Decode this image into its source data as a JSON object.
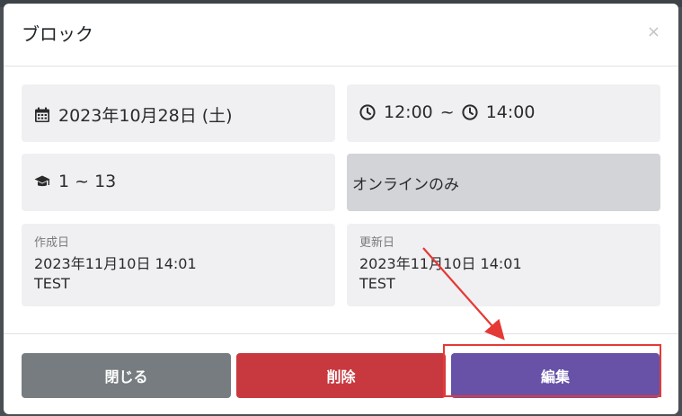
{
  "modal": {
    "title": "ブロック",
    "close_label": "×"
  },
  "date_card": {
    "icon": "calendar-icon",
    "text": "2023年10月28日 (土)"
  },
  "time_card": {
    "icon": "clock-icon",
    "start": "12:00",
    "separator": "~",
    "end": "14:00"
  },
  "seat_card": {
    "icon": "graduation-cap-icon",
    "text": "1 ~ 13"
  },
  "mode_card": {
    "text": "オンラインのみ"
  },
  "created_card": {
    "label": "作成日",
    "datetime": "2023年11月10日 14:01",
    "user": "TEST"
  },
  "updated_card": {
    "label": "更新日",
    "datetime": "2023年11月10日 14:01",
    "user": "TEST"
  },
  "footer": {
    "close_label": "閉じる",
    "delete_label": "削除",
    "edit_label": "編集"
  },
  "colors": {
    "close_button": "#767c7f",
    "delete_button": "#c8393f",
    "edit_button": "#6752a8",
    "annotation": "#e53935"
  }
}
